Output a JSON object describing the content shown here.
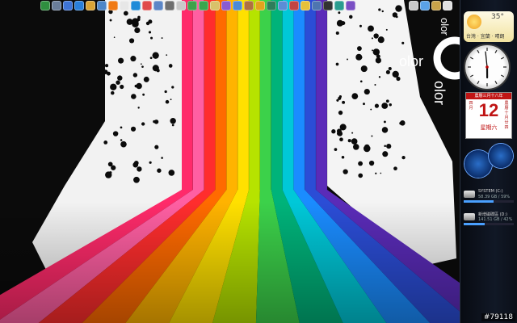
{
  "desktop": {
    "wallpaper_text": {
      "word": "olor",
      "mirror_word": "olor",
      "big_letter": "C"
    },
    "rainbow_colors": [
      "#ff2a6a",
      "#ff5fa2",
      "#ff2d2d",
      "#ff6a00",
      "#ffb300",
      "#ffe000",
      "#b6e300",
      "#3cd14a",
      "#00b37a",
      "#00c8d8",
      "#1a8cff",
      "#2b4dd6",
      "#5a2bb8"
    ]
  },
  "top_icons": [
    {
      "name": "globe-icon",
      "color": "#2f8f3f"
    },
    {
      "name": "tools-icon",
      "color": "#6a7d9a"
    },
    {
      "name": "media-icon",
      "color": "#3e74d6"
    },
    {
      "name": "ie-icon",
      "color": "#2a7fd9"
    },
    {
      "name": "folder-icon",
      "color": "#d9a437"
    },
    {
      "name": "computer-icon",
      "color": "#4e86c8"
    },
    {
      "name": "orange-app-icon",
      "color": "#f07a14"
    },
    {
      "name": "document-icon",
      "color": "#e7e7e7"
    },
    {
      "name": "ie-icon-2",
      "color": "#1f8bd8"
    },
    {
      "name": "paint-icon",
      "color": "#e04b4b"
    },
    {
      "name": "network-icon",
      "color": "#5b86c7"
    },
    {
      "name": "camera-icon",
      "color": "#6f6f6f"
    },
    {
      "name": "grid-icon",
      "color": "#c9c9c9"
    },
    {
      "name": "ftp-icon",
      "color": "#3fa14b"
    },
    {
      "name": "photo-icon",
      "color": "#3aa64e"
    },
    {
      "name": "picture-icon",
      "color": "#d9c26a"
    },
    {
      "name": "note-icon",
      "color": "#8a5bd1"
    },
    {
      "name": "search-icon",
      "color": "#4a8ad6"
    },
    {
      "name": "wrench-icon",
      "color": "#b07040"
    },
    {
      "name": "chrome-icon",
      "color": "#e2a31c"
    },
    {
      "name": "monitor-icon",
      "color": "#2e7d5b"
    },
    {
      "name": "mail-icon",
      "color": "#5b8dd6"
    },
    {
      "name": "shield-icon",
      "color": "#c04444"
    },
    {
      "name": "star-icon",
      "color": "#e5c13a"
    },
    {
      "name": "window-icon",
      "color": "#4e75b0"
    },
    {
      "name": "film-icon",
      "color": "#333333"
    },
    {
      "name": "globe-icon-2",
      "color": "#2a9d8f"
    },
    {
      "name": "music-icon",
      "color": "#7a4fc4"
    }
  ],
  "tray_icons": [
    {
      "name": "notepad-icon",
      "color": "#c8c8c8"
    },
    {
      "name": "users-icon",
      "color": "#5aa2e8"
    },
    {
      "name": "gear-icon",
      "color": "#c9a34a"
    },
    {
      "name": "clipboard-icon",
      "color": "#e0e0e0"
    }
  ],
  "sidebar": {
    "weather": {
      "temp": "35°",
      "location": "台灣 · 宜蘭 · 晴朗"
    },
    "clock": {
      "hour": 5,
      "minute": 59
    },
    "calendar": {
      "header": "農曆三月十八年",
      "day": "12",
      "weekday": "星期六",
      "left_col": "四月",
      "right_col": "農曆十月廿四"
    },
    "drives": [
      {
        "name": "SYSTEM (C:)",
        "info": "58.39 GB / 59%",
        "usage": 59
      },
      {
        "name": "新增磁碟區 (D:)",
        "info": "141.51 GB / 42%",
        "usage": 42
      }
    ]
  },
  "watermark": "#79118"
}
